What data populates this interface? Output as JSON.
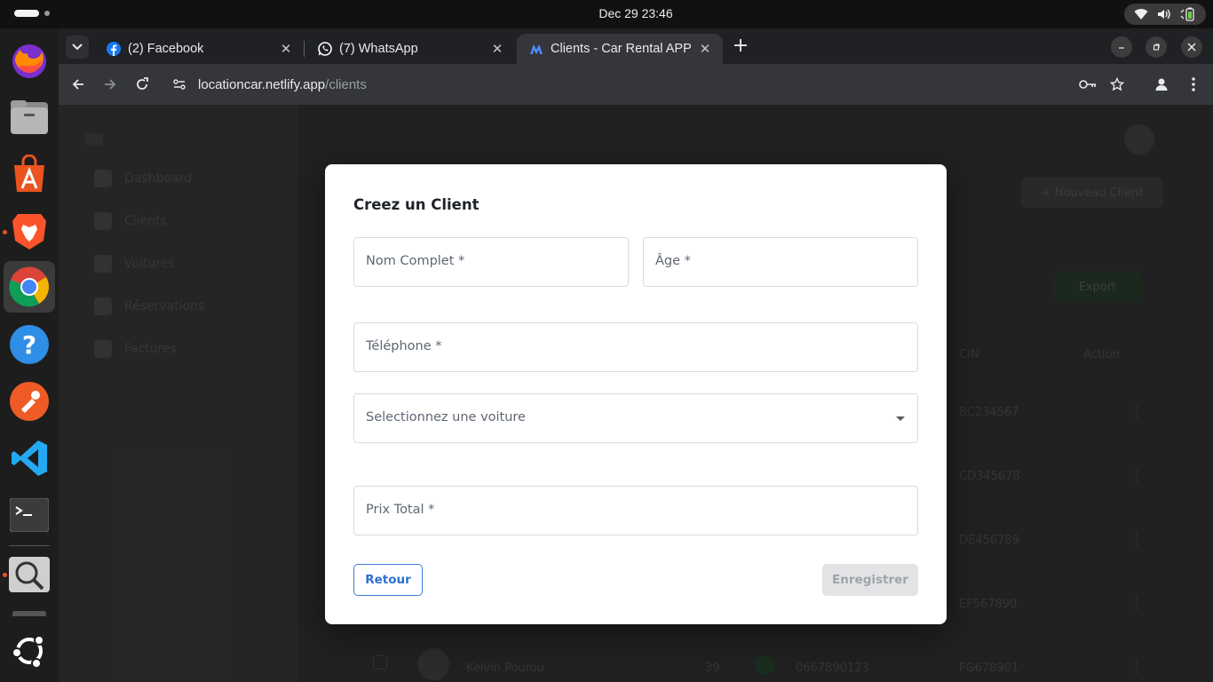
{
  "system": {
    "clock": "Dec 29  23:46"
  },
  "dock": {
    "apps": [
      {
        "name": "firefox",
        "icon": "firefox-icon"
      },
      {
        "name": "files",
        "icon": "files-icon"
      },
      {
        "name": "app-center",
        "icon": "app-center-icon"
      },
      {
        "name": "brave",
        "icon": "brave-icon"
      },
      {
        "name": "chrome",
        "icon": "chrome-icon",
        "active": true
      },
      {
        "name": "help",
        "icon": "help-icon"
      },
      {
        "name": "postman",
        "icon": "postman-icon"
      },
      {
        "name": "vscode",
        "icon": "vscode-icon"
      },
      {
        "name": "terminal",
        "icon": "terminal-icon"
      },
      {
        "name": "image-viewer",
        "icon": "magnifier-icon"
      },
      {
        "name": "show-apps",
        "icon": "ubuntu-icon"
      }
    ]
  },
  "browser": {
    "tabs": [
      {
        "title": "(2) Facebook",
        "icon": "facebook-icon"
      },
      {
        "title": "(7) WhatsApp",
        "icon": "whatsapp-icon"
      },
      {
        "title": "Clients - Car Rental APP",
        "icon": "app-logo-icon",
        "active": true
      }
    ],
    "url_host": "locationcar.netlify.app",
    "url_path": "/clients",
    "close_glyph": "✕",
    "new_tab_glyph": "+"
  },
  "background_page": {
    "sidebar": [
      "Dashboard",
      "Clients",
      "Voitures",
      "Réservations",
      "Factures"
    ],
    "new_client_button": "+ Nouveau Client",
    "export_button": "Export",
    "column_cin": "CIN",
    "column_action": "Action",
    "rows": [
      {
        "cin": "BC234567"
      },
      {
        "cin": "CD345678"
      },
      {
        "cin": "DE456789"
      },
      {
        "cin": "EF567890"
      },
      {
        "name": "Kelvin Pourou",
        "age": "39",
        "phone": "0667890123",
        "cin": "FG678901"
      }
    ]
  },
  "modal": {
    "title": "Creez un Client",
    "fields": {
      "nom_complet": "Nom Complet *",
      "age": "Âge *",
      "telephone": "Téléphone *",
      "voiture": "Selectionnez une voiture",
      "prix_total": "Prix Total *"
    },
    "retour_label": "Retour",
    "enregistrer_label": "Enregistrer"
  },
  "colors": {
    "primary": "#2d6fd2",
    "disabled_bg": "#e2e3e5",
    "chrome_bg": "#202124",
    "toolbar_bg": "#35363a",
    "ubuntu_orange": "#e95420"
  }
}
